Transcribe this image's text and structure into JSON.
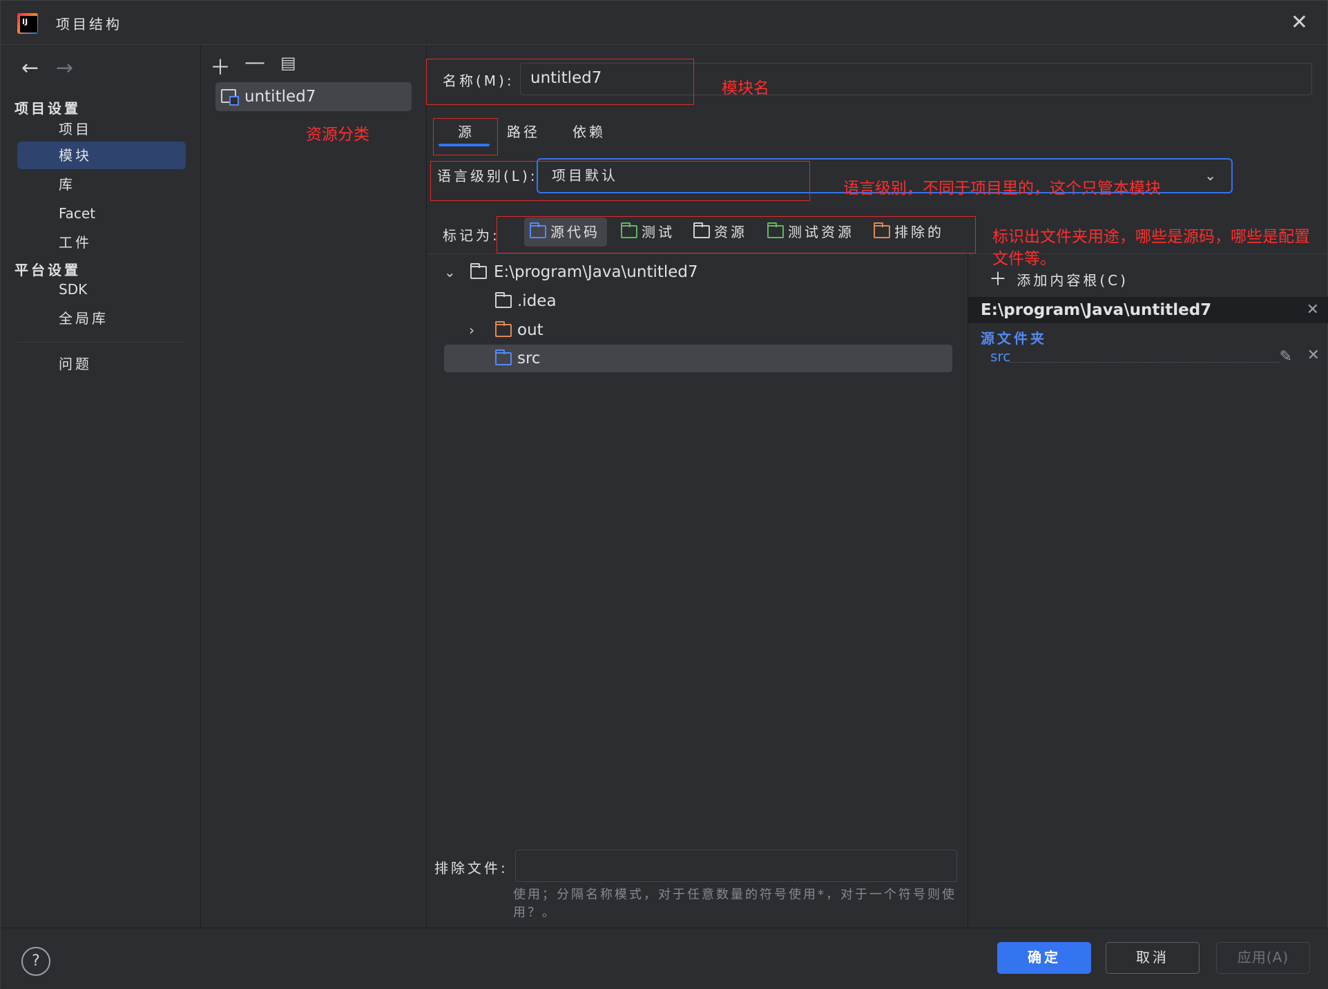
{
  "window": {
    "title": "项目结构"
  },
  "nav": {
    "group_project": "项目设置",
    "item_project": "项目",
    "item_modules": "模块",
    "item_libraries": "库",
    "item_facets": "Facet",
    "item_artifacts": "工件",
    "group_platform": "平台设置",
    "item_sdk": "SDK",
    "item_global_libs": "全局库",
    "item_problems": "问题"
  },
  "modules": {
    "items": [
      "untitled7"
    ]
  },
  "main": {
    "name_label": "名称(M):",
    "name_value": "untitled7",
    "tabs": [
      "源",
      "路径",
      "依赖"
    ],
    "lang_label": "语言级别(L):",
    "lang_value": "项目默认",
    "mark_label": "标记为:",
    "mark_options": [
      "源代码",
      "测试",
      "资源",
      "测试资源",
      "排除的"
    ],
    "tree": {
      "root": "E:\\program\\Java\\untitled7",
      "children": [
        ".idea",
        "out",
        "src"
      ]
    },
    "exclude_label": "排除文件:",
    "exclude_hint": "使用；分隔名称模式，对于任意数量的符号使用*，对于一个符号则使用？。"
  },
  "right_panel": {
    "add_root": "添加内容根(C)",
    "root_path": "E:\\program\\Java\\untitled7",
    "src_folders_title": "源文件夹",
    "src_folder": "src"
  },
  "annotations": {
    "module_name": "模块名",
    "resource_category": "资源分类",
    "language_level": "语言级别，不同于项目里的，这个只管本模块",
    "mark_usage": "标识出文件夹用途，哪些是源码，哪些是配置文件等。"
  },
  "buttons": {
    "ok": "确定",
    "cancel": "取消",
    "apply": "应用(A)"
  },
  "colors": {
    "accent": "#3574f0",
    "annotation": "#ff2e2e",
    "selection": "#2e436e"
  }
}
